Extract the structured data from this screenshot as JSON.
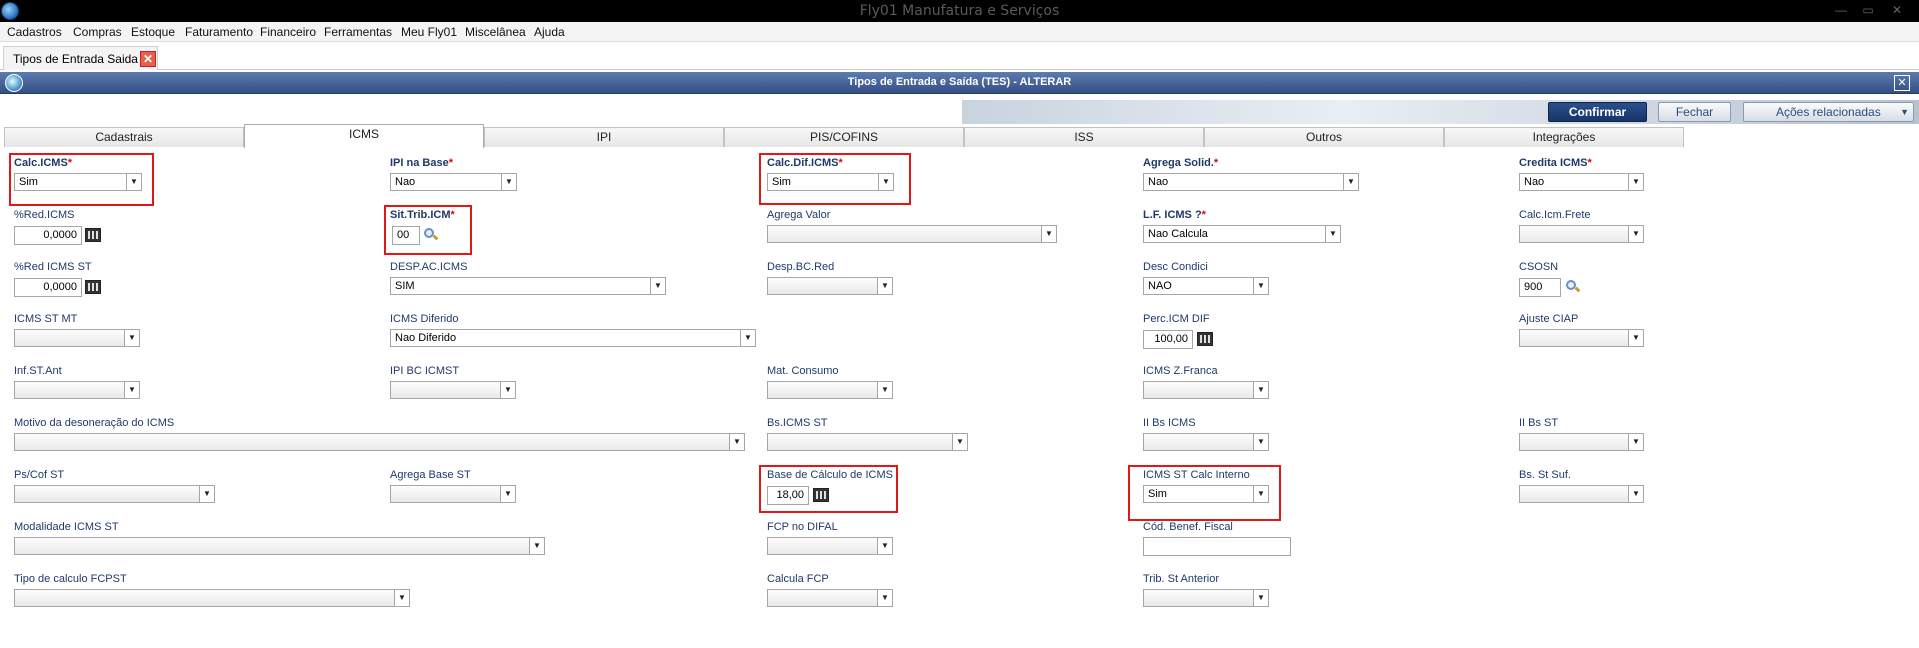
{
  "window": {
    "title": "Fly01 Manufatura e Serviços",
    "controls": [
      "—",
      "▭",
      "✕"
    ]
  },
  "menu": [
    "Cadastros",
    "Compras",
    "Estoque",
    "Faturamento",
    "Financeiro",
    "Ferramentas",
    "Meu Fly01",
    "Miscelânea",
    "Ajuda"
  ],
  "doc_tab": {
    "label": "Tipos de Entrada Saida",
    "close": "✕"
  },
  "form": {
    "title": "Tipos de Entrada e Saída (TES) - ALTERAR",
    "close": "✕"
  },
  "actions": {
    "confirm": "Confirmar",
    "close": "Fechar",
    "related": "Ações relacionadas",
    "related_arrow": "▼"
  },
  "tabs": [
    "Cadastrais",
    "ICMS",
    "IPI",
    "PIS/COFINS",
    "ISS",
    "Outros",
    "Integrações"
  ],
  "active_tab": "ICMS",
  "required_mark": "*",
  "fields": {
    "calc_icms": {
      "label": "Calc.ICMS",
      "value": "Sim"
    },
    "ipi_na_base": {
      "label": "IPI na Base",
      "value": "Nao"
    },
    "calc_dif_icms": {
      "label": "Calc.Dif.ICMS",
      "value": "Sim"
    },
    "agrega_solid": {
      "label": "Agrega Solid.",
      "value": "Nao"
    },
    "credita_icms": {
      "label": "Credita ICMS",
      "value": "Nao"
    },
    "red_icms": {
      "label": "%Red.ICMS",
      "value": "0,0000"
    },
    "sit_trib_icm": {
      "label": "Sit.Trib.ICM",
      "value": "00"
    },
    "agrega_valor": {
      "label": "Agrega Valor",
      "value": ""
    },
    "lf_icms": {
      "label": "L.F. ICMS ?",
      "value": "Nao Calcula"
    },
    "calc_icm_frete": {
      "label": "Calc.Icm.Frete",
      "value": ""
    },
    "red_icms_st": {
      "label": "%Red ICMS ST",
      "value": "0,0000"
    },
    "desp_ac_icms": {
      "label": "DESP.AC.ICMS",
      "value": "SIM"
    },
    "desp_bc_red": {
      "label": "Desp.BC.Red",
      "value": ""
    },
    "desc_condici": {
      "label": "Desc Condici",
      "value": "NAO"
    },
    "csosn": {
      "label": "CSOSN",
      "value": "900"
    },
    "icms_st_mt": {
      "label": "ICMS ST MT",
      "value": ""
    },
    "icms_diferido": {
      "label": "ICMS Diferido",
      "value": "Nao Diferido"
    },
    "perc_icm_dif": {
      "label": "Perc.ICM DIF",
      "value": "100,00"
    },
    "ajuste_ciap": {
      "label": "Ajuste CIAP",
      "value": ""
    },
    "inf_st_ant": {
      "label": "Inf.ST.Ant",
      "value": ""
    },
    "ipi_bc_icmst": {
      "label": "IPI BC ICMST",
      "value": ""
    },
    "mat_consumo": {
      "label": "Mat. Consumo",
      "value": ""
    },
    "icms_z_franca": {
      "label": "ICMS Z.Franca",
      "value": ""
    },
    "motivo_desoneracao": {
      "label": "Motivo da desoneração do ICMS",
      "value": ""
    },
    "bs_icms_st": {
      "label": "Bs.ICMS ST",
      "value": ""
    },
    "ii_bs_icms": {
      "label": "II Bs ICMS",
      "value": ""
    },
    "ii_bs_st": {
      "label": "II Bs ST",
      "value": ""
    },
    "ps_cof_st": {
      "label": "Ps/Cof ST",
      "value": ""
    },
    "agrega_base_st": {
      "label": "Agrega Base ST",
      "value": ""
    },
    "base_calc_icms": {
      "label": "Base de Cálculo de ICMS",
      "value": "18,00"
    },
    "icms_st_calc_interno": {
      "label": "ICMS ST Calc Interno",
      "value": "Sim"
    },
    "bs_st_suf": {
      "label": "Bs. St Suf.",
      "value": ""
    },
    "modalidade_icms_st": {
      "label": "Modalidade ICMS ST",
      "value": ""
    },
    "fcp_no_difal": {
      "label": "FCP no DIFAL",
      "value": ""
    },
    "cod_benef_fiscal": {
      "label": "Cód. Benef. Fiscal",
      "value": ""
    },
    "tipo_calculo_fcpst": {
      "label": "Tipo de calculo FCPST",
      "value": ""
    },
    "calcula_fcp": {
      "label": "Calcula FCP",
      "value": ""
    },
    "trib_st_anterior": {
      "label": "Trib. St Anterior",
      "value": ""
    }
  },
  "colors": {
    "menu_bg": "#f4f4f4",
    "form_bar": "#344e86",
    "label": "#1f3a69",
    "required": "#d01010",
    "highlight": "#e01818",
    "confirm_bg": "#163568"
  }
}
